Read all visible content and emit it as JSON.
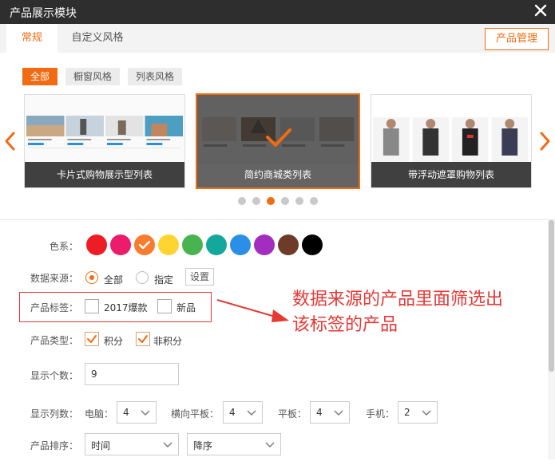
{
  "window": {
    "title": "产品展示模块",
    "close_icon": "close-icon"
  },
  "tabs": [
    {
      "label": "常规",
      "active": true
    },
    {
      "label": "自定义风格",
      "active": false
    }
  ],
  "manage_button": "产品管理",
  "filters": [
    {
      "label": "全部",
      "active": true
    },
    {
      "label": "橱窗风格",
      "active": false
    },
    {
      "label": "列表风格",
      "active": false
    }
  ],
  "carousel": {
    "cards": [
      {
        "label": "卡片式购物展示型列表",
        "selected": false
      },
      {
        "label": "简约商城类列表",
        "selected": true
      },
      {
        "label": "带浮动遮罩购物列表",
        "selected": false
      }
    ],
    "dots_count": 6,
    "active_dot": 2
  },
  "form": {
    "color_label": "色系：",
    "colors": [
      "#ee1c25",
      "#ec1b6b",
      "#f97b2d",
      "#fdd430",
      "#49b350",
      "#14a89c",
      "#2a8fe6",
      "#a32dbf",
      "#6d3b28",
      "#000000"
    ],
    "selected_color_index": 2,
    "source_label": "数据来源：",
    "source_options": [
      "全部",
      "指定"
    ],
    "source_selected": "全部",
    "settings_button": "设置",
    "tag_label": "产品标签：",
    "tag_options": [
      "2017爆款",
      "新品"
    ],
    "type_label": "产品类型：",
    "type_options": [
      "积分",
      "非积分"
    ],
    "count_label": "显示个数：",
    "count_value": "9",
    "columns_label": "显示列数：",
    "columns": [
      {
        "label": "电脑：",
        "value": "4"
      },
      {
        "label": "横向平板：",
        "value": "4"
      },
      {
        "label": "平板：",
        "value": "4"
      },
      {
        "label": "手机：",
        "value": "2"
      }
    ],
    "sort_label": "产品排序：",
    "sort_field": "时间",
    "sort_order": "降序"
  },
  "annotation": {
    "line1": "数据来源的产品里面筛选出",
    "line2": "该标签的产品",
    "color": "#e53935"
  },
  "accent_color": "#f06b12"
}
